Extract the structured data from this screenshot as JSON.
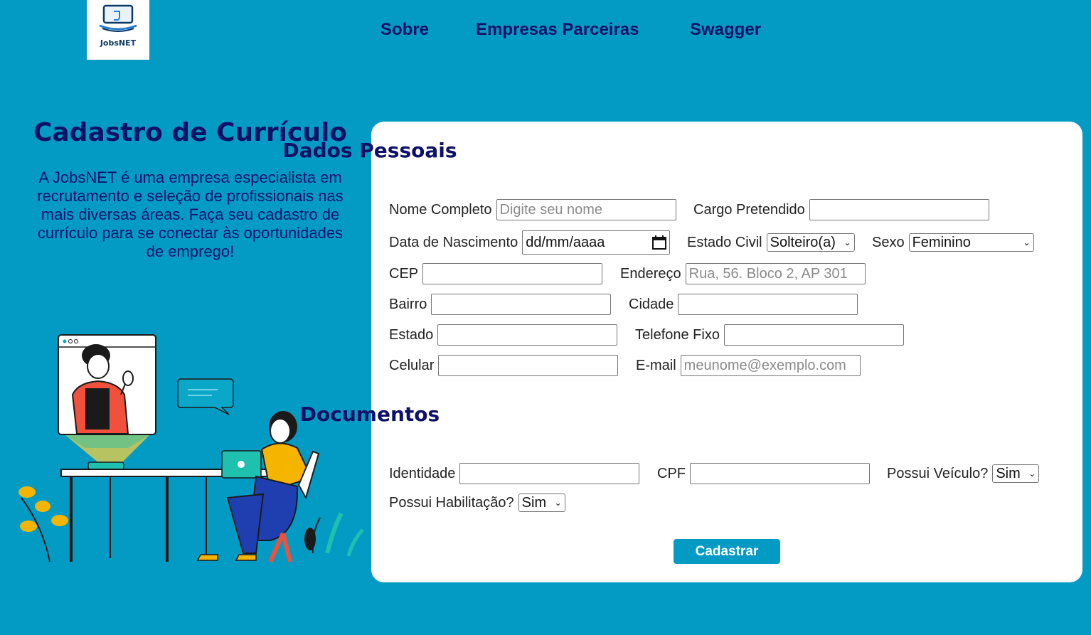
{
  "brand": {
    "logo_text": "JobsNET"
  },
  "nav": {
    "about": "Sobre",
    "partners": "Empresas Parceiras",
    "swagger": "Swagger"
  },
  "hero": {
    "title": "Cadastro de Currículo",
    "description": "A JobsNET é uma empresa especialista em recrutamento e seleção de profissionais nas mais diversas áreas. Faça seu cadastro de currículo para se conectar às oportunidades de emprego!"
  },
  "personal": {
    "title": "Dados Pessoais",
    "name": {
      "label": "Nome Completo",
      "placeholder": "Digite seu nome",
      "value": ""
    },
    "role": {
      "label": "Cargo Pretendido",
      "value": ""
    },
    "birth": {
      "label": "Data de Nascimento",
      "value": "dd/mm/aaaa"
    },
    "marital": {
      "label": "Estado Civil",
      "value": "Solteiro(a)"
    },
    "sex": {
      "label": "Sexo",
      "value": "Feminino"
    },
    "cep": {
      "label": "CEP",
      "value": ""
    },
    "address": {
      "label": "Endereço",
      "placeholder": "Rua, 56. Bloco 2, AP 301",
      "value": ""
    },
    "district": {
      "label": "Bairro",
      "value": ""
    },
    "city": {
      "label": "Cidade",
      "value": ""
    },
    "state": {
      "label": "Estado",
      "value": ""
    },
    "landline": {
      "label": "Telefone Fixo",
      "value": ""
    },
    "mobile": {
      "label": "Celular",
      "value": ""
    },
    "email": {
      "label": "E-mail",
      "placeholder": "meunome@exemplo.com",
      "value": ""
    }
  },
  "documents": {
    "title": "Documentos",
    "identity": {
      "label": "Identidade",
      "value": ""
    },
    "cpf": {
      "label": "CPF",
      "value": ""
    },
    "vehicle": {
      "label": "Possui Veículo?",
      "value": "Sim"
    },
    "license": {
      "label": "Possui Habilitação?",
      "value": "Sim"
    }
  },
  "submit_label": "Cadastrar",
  "colors": {
    "background": "#039bc3",
    "heading": "#0d1168",
    "card": "#ffffff",
    "button": "#039bc3"
  }
}
